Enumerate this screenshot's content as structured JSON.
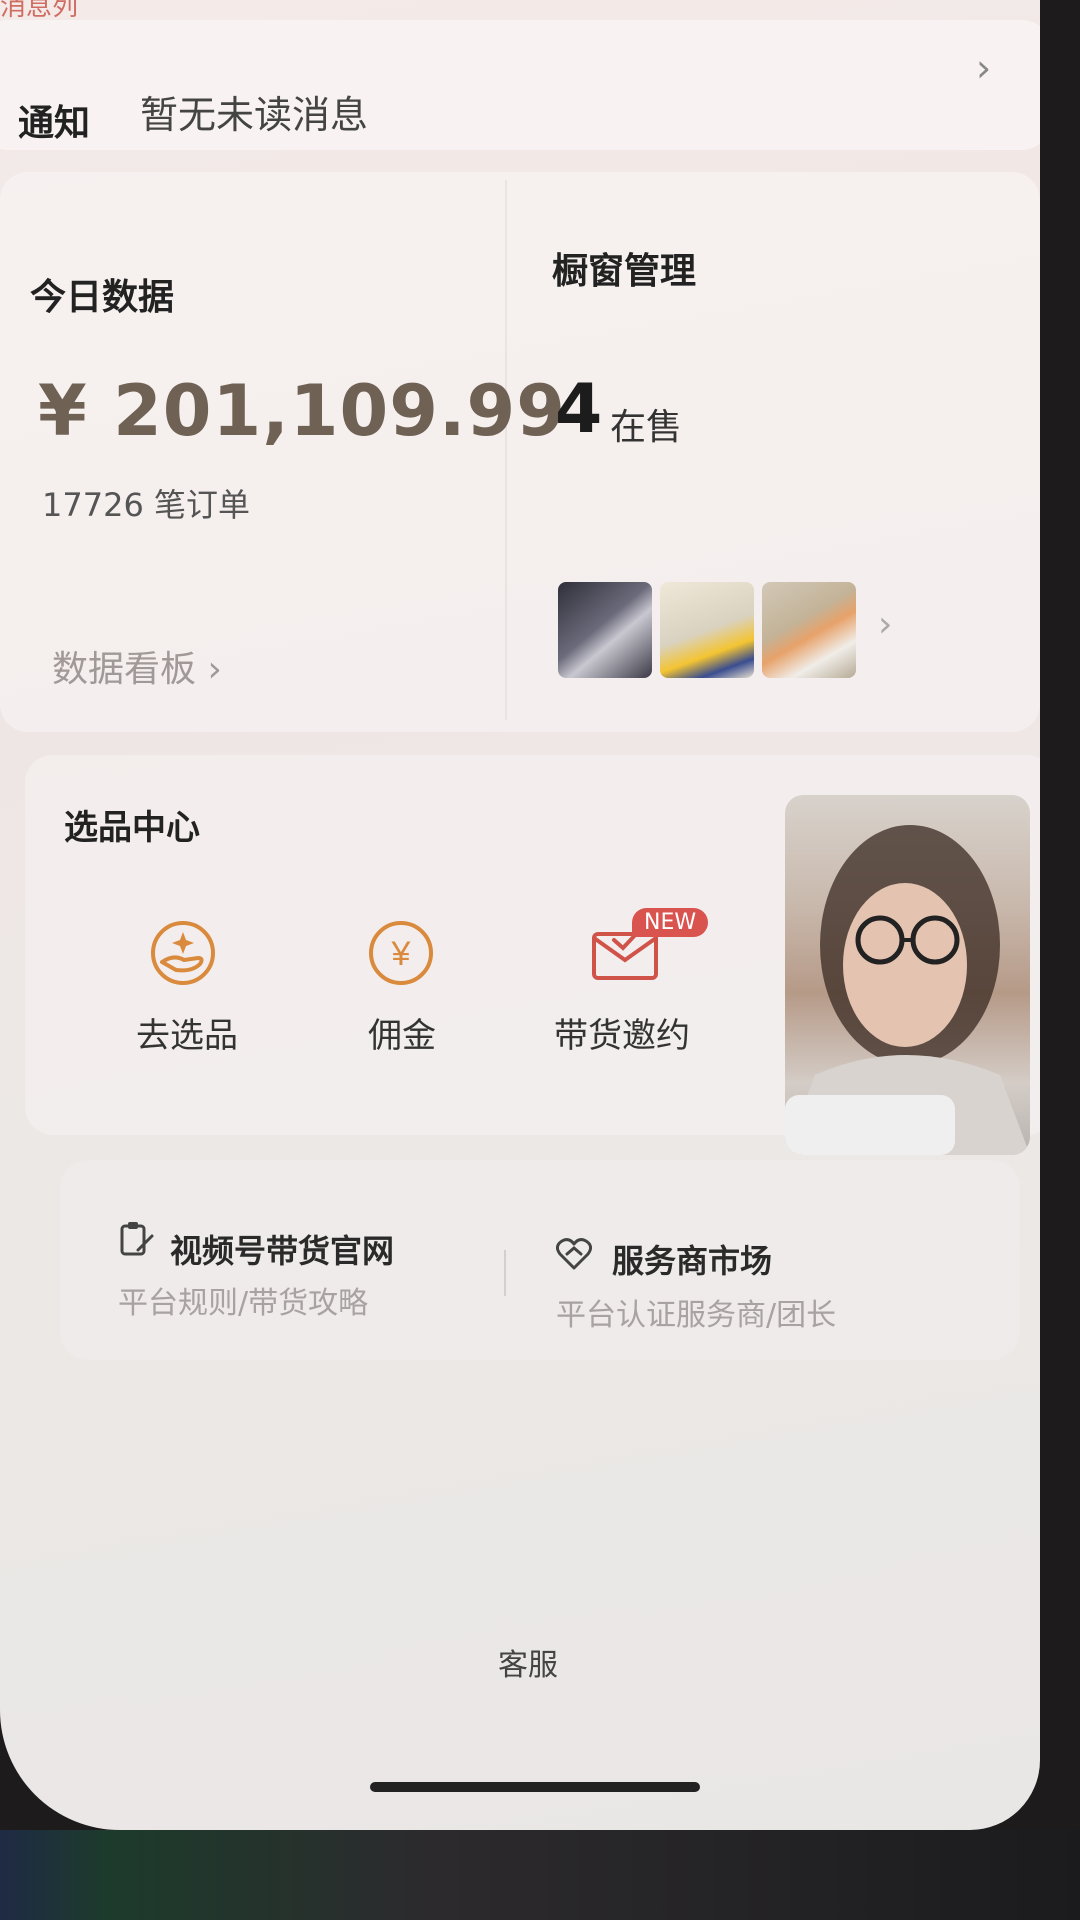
{
  "top_partial_text": "消息列",
  "notice": {
    "label": "通知",
    "text": "暂无未读消息",
    "chevron": "›"
  },
  "today": {
    "title": "今日数据",
    "amount": "¥ 201,109.99",
    "orders": "17726 笔订单",
    "dashboard_link": "数据看板 ›"
  },
  "window": {
    "title": "橱窗管理",
    "count": "4",
    "count_label": "在售",
    "thumb_chevron": "›"
  },
  "selection": {
    "title": "选品中心",
    "items": [
      {
        "label": "去选品",
        "icon": "hand-sparkle-icon"
      },
      {
        "label": "佣金",
        "icon": "yuan-coin-icon"
      },
      {
        "label": "带货邀约",
        "icon": "envelope-check-icon",
        "badge": "NEW"
      }
    ]
  },
  "links": {
    "left": {
      "title": "视频号带货官网",
      "subtitle": "平台规则/带货攻略",
      "icon": "clipboard-pen-icon"
    },
    "right": {
      "title": "服务商市场",
      "subtitle": "平台认证服务商/团长",
      "icon": "handshake-heart-icon"
    }
  },
  "footer": {
    "service": "客服"
  },
  "colors": {
    "accent": "#d98a3d",
    "badge": "#d9534f",
    "amount": "#6f6254"
  }
}
